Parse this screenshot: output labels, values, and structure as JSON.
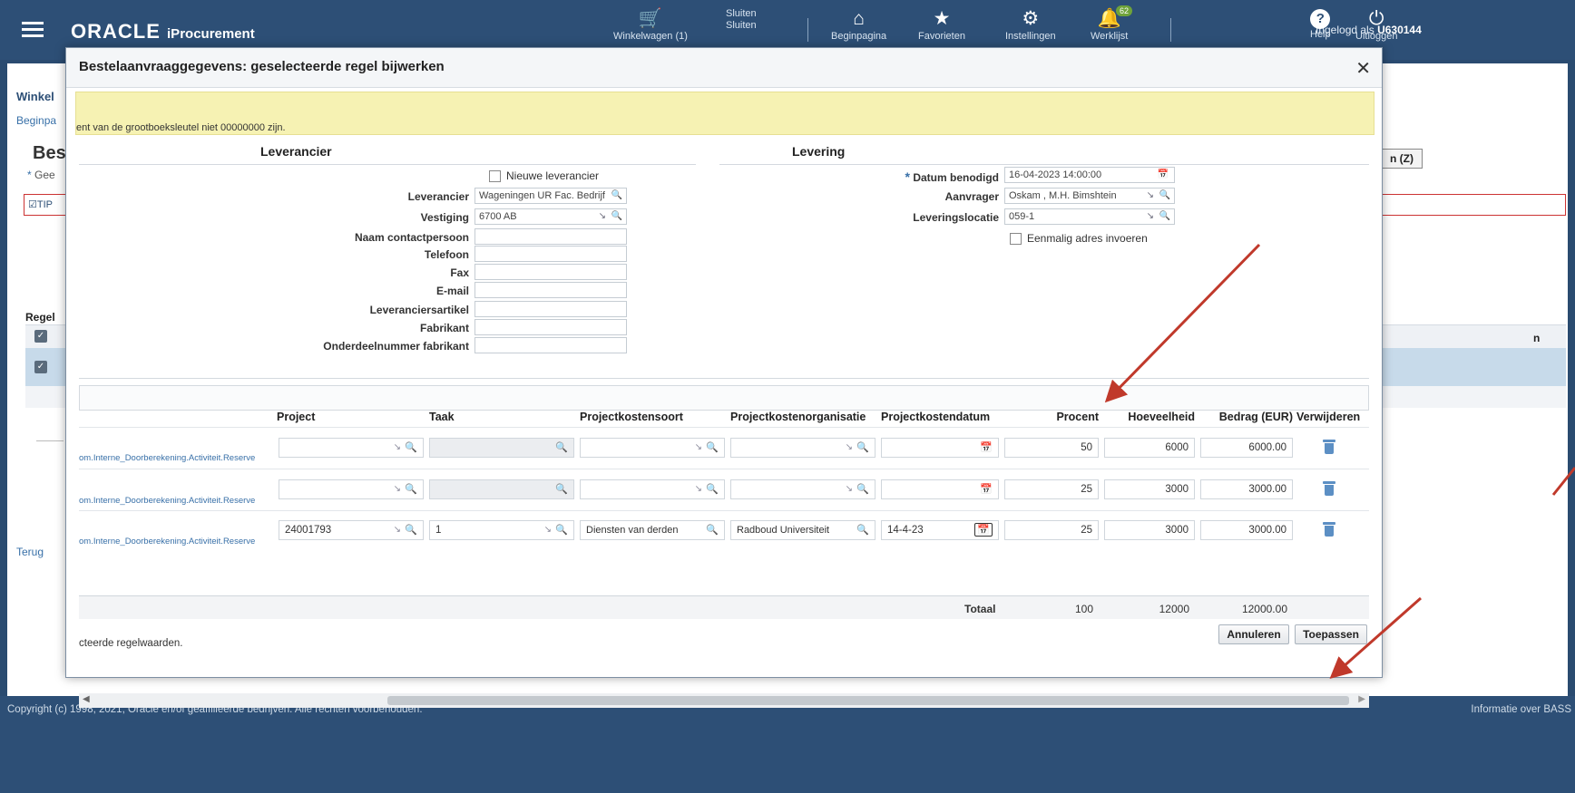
{
  "header": {
    "brand": "ORACLE",
    "product": "iProcurement",
    "cart_label": "Winkelwagen (1)",
    "close_image_alt": "Sluiten",
    "close_label": "Sluiten",
    "home_label": "Beginpagina",
    "favorites_label": "Favorieten",
    "settings_label": "Instellingen",
    "worklist_label": "Werklijst",
    "worklist_count": "62",
    "logged_in_prefix": "Ingelogd als",
    "username": "U630144",
    "help_label": "Help",
    "logout_label": "Uitloggen"
  },
  "background_page": {
    "tab": "Winkel",
    "breadcrumb": "Beginpa",
    "title": "Best",
    "required_note": "Gee",
    "tip": "TIP",
    "z_button": "n (Z)",
    "regel": "Regel",
    "col_n": "n",
    "back_link": "Terug"
  },
  "modal": {
    "title": "Bestelaanvraaggegevens: geselecteerde regel bijwerken",
    "warning_text": "ent van de grootboeksleutel niet 00000000 zijn.",
    "supplier_section": "Leverancier",
    "delivery_section": "Levering",
    "supplier": {
      "new_supplier_label": "Nieuwe leverancier",
      "fields": [
        {
          "label": "Leverancier",
          "value": "Wageningen UR Fac. Bedrijf"
        },
        {
          "label": "Vestiging",
          "value": "6700 AB"
        },
        {
          "label": "Naam contactpersoon",
          "value": ""
        },
        {
          "label": "Telefoon",
          "value": ""
        },
        {
          "label": "Fax",
          "value": ""
        },
        {
          "label": "E-mail",
          "value": ""
        },
        {
          "label": "Leveranciersartikel",
          "value": ""
        },
        {
          "label": "Fabrikant",
          "value": ""
        },
        {
          "label": "Onderdeelnummer fabrikant",
          "value": ""
        }
      ]
    },
    "delivery": {
      "date_label": "Datum benodigd",
      "date_value": "16-04-2023 14:00:00",
      "requester_label": "Aanvrager",
      "requester_value": "Oskam , M.H. Bimshtein",
      "location_label": "Leveringslocatie",
      "location_value": "059-1",
      "one_time_address_label": "Eenmalig adres invoeren"
    },
    "table": {
      "headers": {
        "project": "Project",
        "task": "Taak",
        "cost_type": "Projectkostensoort",
        "cost_org": "Projectkostenorganisatie",
        "cost_date": "Projectkostendatum",
        "percent": "Procent",
        "quantity": "Hoeveelheid",
        "amount": "Bedrag (EUR)",
        "delete": "Verwijderen"
      },
      "rows": [
        {
          "account": "om.Interne_Doorberekening.Activiteit.Reserve",
          "project": "",
          "task": "",
          "cost_type": "",
          "cost_org": "",
          "cost_date": "",
          "percent": "50",
          "quantity": "6000",
          "amount": "6000.00"
        },
        {
          "account": "om.Interne_Doorberekening.Activiteit.Reserve",
          "project": "",
          "task": "",
          "cost_type": "",
          "cost_org": "",
          "cost_date": "",
          "percent": "25",
          "quantity": "3000",
          "amount": "3000.00"
        },
        {
          "account": "om.Interne_Doorberekening.Activiteit.Reserve",
          "project": "24001793",
          "task": "1",
          "cost_type": "Diensten van derden",
          "cost_org": "Radboud Universiteit",
          "cost_date": "14-4-23",
          "percent": "25",
          "quantity": "3000",
          "amount": "3000.00"
        }
      ],
      "total_label": "Totaal",
      "total_percent": "100",
      "total_quantity": "12000",
      "total_amount": "12000.00"
    },
    "note": "cteerde regelwaarden.",
    "cancel_button": "Annuleren",
    "apply_button": "Toepassen"
  },
  "footer": {
    "copyright": "Copyright (c) 1998, 2021, Oracle en/of geaffilieerde bedrijven. Alle rechten voorbehouden.",
    "about": "Informatie over BASS"
  },
  "colors": {
    "header_bg": "#2d4f76",
    "warning_bg": "#f6f2b3",
    "link": "#3870a8",
    "arrow": "#c0392b"
  }
}
